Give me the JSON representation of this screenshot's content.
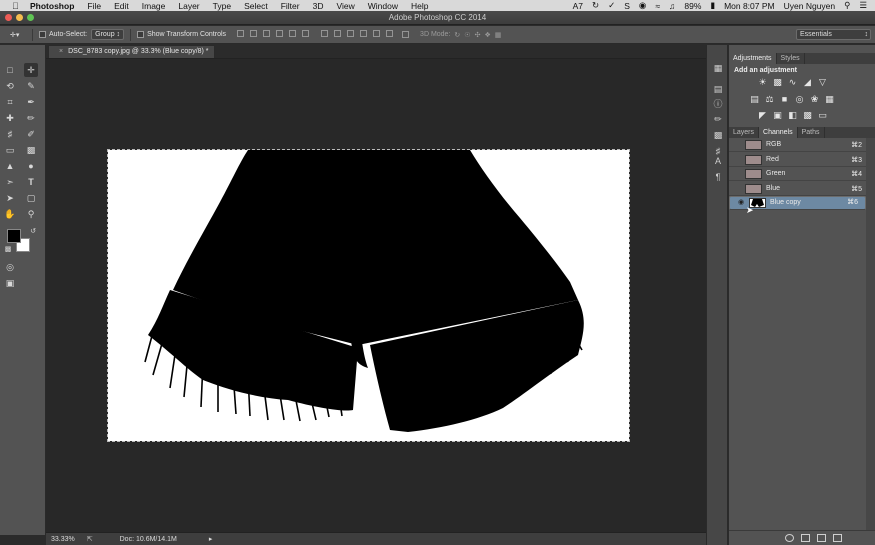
{
  "menubar": {
    "app": "Photoshop",
    "menus": [
      "File",
      "Edit",
      "Image",
      "Layer",
      "Type",
      "Select",
      "Filter",
      "3D",
      "View",
      "Window",
      "Help"
    ],
    "status": {
      "battery": "89%",
      "clock": "Mon 8:07 PM",
      "user": "Uyen Nguyen",
      "indicator": "7"
    }
  },
  "window": {
    "title": "Adobe Photoshop CC 2014"
  },
  "options": {
    "auto_select_label": "Auto-Select:",
    "auto_select_value": "Group",
    "transform_label": "Show Transform Controls",
    "mode_label": "3D Mode:",
    "workspace": "Essentials"
  },
  "document": {
    "tab_title": "DSC_8783 copy.jpg @ 33.3% (Blue copy/8) *",
    "zoom": "33.33%",
    "doc_size": "Doc: 10.6M/14.1M"
  },
  "adjustments": {
    "tabs": [
      "Adjustments",
      "Styles"
    ],
    "header": "Add an adjustment"
  },
  "channels_panel": {
    "tabs": [
      "Layers",
      "Channels",
      "Paths"
    ],
    "rows": [
      {
        "name": "RGB",
        "shortcut": "⌘2"
      },
      {
        "name": "Red",
        "shortcut": "⌘3"
      },
      {
        "name": "Green",
        "shortcut": "⌘4"
      },
      {
        "name": "Blue",
        "shortcut": "⌘5"
      },
      {
        "name": "Blue copy",
        "shortcut": "⌘6"
      }
    ]
  },
  "colors": {
    "accent_selected": "#6d89a3",
    "foreground": "#000000",
    "background": "#ffffff"
  }
}
